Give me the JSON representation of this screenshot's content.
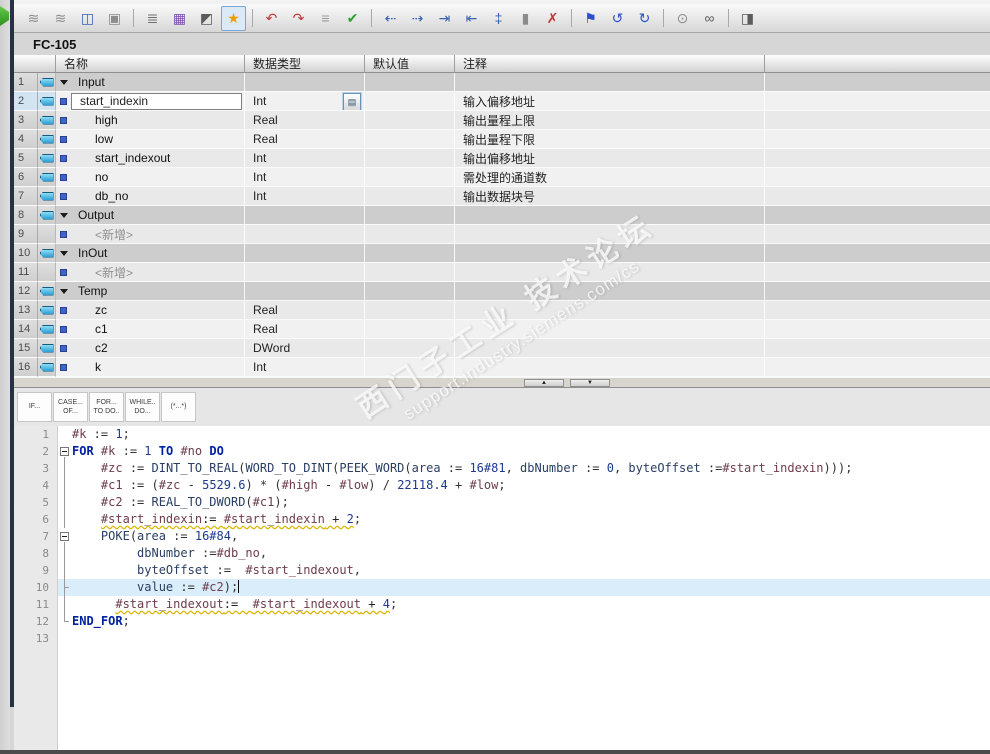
{
  "window": {
    "block_title": "FC-105"
  },
  "toolbar": {
    "icons": [
      {
        "name": "insert-network-icon",
        "glyph": "≋",
        "color": "#8c8c8c"
      },
      {
        "name": "insert-empty-box-icon",
        "glyph": "≋",
        "color": "#8c8c8c"
      },
      {
        "name": "open-block-icon",
        "glyph": "◫",
        "color": "#3a62b0"
      },
      {
        "name": "paste-block-icon",
        "glyph": "▣",
        "color": "#8c8c8c"
      },
      {
        "sep": true
      },
      {
        "name": "network-list-icon",
        "glyph": "≣",
        "color": "#6d6d6d"
      },
      {
        "name": "db-block-icon",
        "glyph": "▦",
        "color": "#7a4fb0"
      },
      {
        "name": "absolute-operands-icon",
        "glyph": "◩",
        "color": "#5c5c5c"
      },
      {
        "name": "snippets-icon",
        "glyph": "★",
        "color": "#e8a000",
        "active": true
      },
      {
        "sep": true
      },
      {
        "name": "undo-call-icon",
        "glyph": "↶",
        "color": "#c23434"
      },
      {
        "name": "redo-call-icon",
        "glyph": "↷",
        "color": "#c23434"
      },
      {
        "name": "format-lines-icon",
        "glyph": "≡",
        "color": "#9a9a9a"
      },
      {
        "name": "consistency-check-icon",
        "glyph": "✔",
        "color": "#2f9e2f"
      },
      {
        "sep": true
      },
      {
        "name": "collapse-folds-icon",
        "glyph": "⇠",
        "color": "#3a62b0"
      },
      {
        "name": "expand-folds-icon",
        "glyph": "⇢",
        "color": "#3a62b0"
      },
      {
        "name": "indent-icon",
        "glyph": "⇥",
        "color": "#3a62b0"
      },
      {
        "name": "outdent-icon",
        "glyph": "⇤",
        "color": "#3a62b0"
      },
      {
        "name": "renumber-icon",
        "glyph": "‡",
        "color": "#3a62b0"
      },
      {
        "name": "absolute-relative-icon",
        "glyph": "▮",
        "color": "#8c8c8c"
      },
      {
        "name": "remove-marks-icon",
        "glyph": "✗",
        "color": "#c23434"
      },
      {
        "sep": true
      },
      {
        "name": "bookmark-icon",
        "glyph": "⚑",
        "color": "#2a4fd0"
      },
      {
        "name": "previous-position-icon",
        "glyph": "↺",
        "color": "#2a4fd0"
      },
      {
        "name": "next-position-icon",
        "glyph": "↻",
        "color": "#2a4fd0"
      },
      {
        "sep": true
      },
      {
        "name": "find-replace-icon",
        "glyph": "⊙",
        "color": "#8c8c8c"
      },
      {
        "name": "monitor-glasses-icon",
        "glyph": "∞",
        "color": "#5c5c5c"
      },
      {
        "sep": true
      },
      {
        "name": "switch-view-icon",
        "glyph": "◨",
        "color": "#5c5c5c"
      }
    ]
  },
  "table": {
    "headers": {
      "name": "名称",
      "type": "数据类型",
      "default": "默认值",
      "comment": "注释"
    },
    "rows": [
      {
        "num": "1",
        "kind": "section",
        "icon": true,
        "name": "Input",
        "type": "",
        "comment": ""
      },
      {
        "num": "2",
        "kind": "edit",
        "icon": true,
        "name": "start_indexin",
        "type": "Int",
        "comment": "输入偏移地址",
        "browse": true,
        "selected": true
      },
      {
        "num": "3",
        "kind": "child",
        "icon": true,
        "name": "high",
        "type": "Real",
        "comment": "输出量程上限"
      },
      {
        "num": "4",
        "kind": "child",
        "icon": true,
        "name": "low",
        "type": "Real",
        "comment": "输出量程下限"
      },
      {
        "num": "5",
        "kind": "child",
        "icon": true,
        "name": "start_indexout",
        "type": "Int",
        "comment": "输出偏移地址"
      },
      {
        "num": "6",
        "kind": "child",
        "icon": true,
        "name": "no",
        "type": "Int",
        "comment": "需处理的通道数"
      },
      {
        "num": "7",
        "kind": "child",
        "icon": true,
        "name": "db_no",
        "type": "Int",
        "comment": "输出数据块号"
      },
      {
        "num": "8",
        "kind": "section",
        "icon": true,
        "name": "Output",
        "type": "",
        "comment": ""
      },
      {
        "num": "9",
        "kind": "new",
        "icon": false,
        "name": "<新增>",
        "type": "",
        "comment": ""
      },
      {
        "num": "10",
        "kind": "section",
        "icon": true,
        "name": "InOut",
        "type": "",
        "comment": ""
      },
      {
        "num": "11",
        "kind": "new",
        "icon": false,
        "name": "<新增>",
        "type": "",
        "comment": ""
      },
      {
        "num": "12",
        "kind": "section",
        "icon": true,
        "name": "Temp",
        "type": "",
        "comment": ""
      },
      {
        "num": "13",
        "kind": "child",
        "icon": true,
        "name": "zc",
        "type": "Real",
        "comment": ""
      },
      {
        "num": "14",
        "kind": "child",
        "icon": true,
        "name": "c1",
        "type": "Real",
        "comment": ""
      },
      {
        "num": "15",
        "kind": "child",
        "icon": true,
        "name": "c2",
        "type": "DWord",
        "comment": ""
      },
      {
        "num": "16",
        "kind": "child",
        "icon": true,
        "name": "k",
        "type": "Int",
        "comment": ""
      }
    ]
  },
  "splitter": {
    "up_glyph": "▲",
    "down_glyph": "▼"
  },
  "snippets": {
    "buttons": [
      {
        "name": "snippet-if-button",
        "lines": [
          "IF..."
        ]
      },
      {
        "name": "snippet-case-button",
        "lines": [
          "CASE...",
          "OF..."
        ]
      },
      {
        "name": "snippet-for-button",
        "lines": [
          "FOR...",
          "TO DO.."
        ]
      },
      {
        "name": "snippet-while-button",
        "lines": [
          "WHILE..",
          "DO..."
        ]
      },
      {
        "name": "snippet-comment-button",
        "lines": [
          "(*...*)"
        ]
      }
    ]
  },
  "code": {
    "lines": [
      {
        "n": "1",
        "fold": "",
        "seg": [
          [
            "#k",
            "var"
          ],
          [
            " := "
          ],
          [
            "1",
            "num"
          ],
          [
            ";"
          ]
        ]
      },
      {
        "n": "2",
        "fold": "box",
        "seg": [
          [
            "FOR",
            "kw"
          ],
          [
            " "
          ],
          [
            "#k",
            "var"
          ],
          [
            " := "
          ],
          [
            "1",
            "num"
          ],
          [
            " "
          ],
          [
            "TO",
            "kw"
          ],
          [
            " "
          ],
          [
            "#no",
            "var"
          ],
          [
            " "
          ],
          [
            "DO",
            "kw"
          ]
        ]
      },
      {
        "n": "3",
        "fold": "bar",
        "seg": [
          [
            "    "
          ],
          [
            "#zc",
            "var"
          ],
          [
            " := "
          ],
          [
            "DINT_TO_REAL",
            "fn"
          ],
          [
            "("
          ],
          [
            "WORD_TO_DINT",
            "fn"
          ],
          [
            "("
          ],
          [
            "PEEK_WORD",
            "fn"
          ],
          [
            "("
          ],
          [
            "area",
            "fn"
          ],
          [
            " := "
          ],
          [
            "16#81",
            "num"
          ],
          [
            ", "
          ],
          [
            "dbNumber",
            "fn"
          ],
          [
            " := "
          ],
          [
            "0",
            "num"
          ],
          [
            ", "
          ],
          [
            "byteOffset",
            "fn"
          ],
          [
            " :="
          ],
          [
            "#start_indexin",
            "var"
          ],
          [
            ")));"
          ]
        ]
      },
      {
        "n": "4",
        "fold": "bar",
        "seg": [
          [
            "    "
          ],
          [
            "#c1",
            "var"
          ],
          [
            " := ("
          ],
          [
            "#zc",
            "var"
          ],
          [
            " - "
          ],
          [
            "5529.6",
            "num"
          ],
          [
            ") * ("
          ],
          [
            "#high",
            "var"
          ],
          [
            " - "
          ],
          [
            "#low",
            "var"
          ],
          [
            ") / "
          ],
          [
            "22118.4",
            "num"
          ],
          [
            " + "
          ],
          [
            "#low",
            "var"
          ],
          [
            ";"
          ]
        ]
      },
      {
        "n": "5",
        "fold": "bar",
        "seg": [
          [
            "    "
          ],
          [
            "#c2",
            "var"
          ],
          [
            " := "
          ],
          [
            "REAL_TO_DWORD",
            "fn"
          ],
          [
            "("
          ],
          [
            "#c1",
            "var"
          ],
          [
            ");"
          ]
        ]
      },
      {
        "n": "6",
        "fold": "bar",
        "seg": [
          [
            "    "
          ],
          [
            "#start_indexin",
            "var warn"
          ],
          [
            ":= ",
            "warn"
          ],
          [
            "#start_indexin",
            "var warn"
          ],
          [
            " + ",
            "warn"
          ],
          [
            "2",
            "num warn"
          ],
          [
            ";"
          ]
        ]
      },
      {
        "n": "7",
        "fold": "box",
        "seg": [
          [
            "    "
          ],
          [
            "POKE",
            "fn"
          ],
          [
            "("
          ],
          [
            "area",
            "fn"
          ],
          [
            " := "
          ],
          [
            "16#84",
            "num"
          ],
          [
            ","
          ]
        ]
      },
      {
        "n": "8",
        "fold": "bar",
        "seg": [
          [
            "         "
          ],
          [
            "dbNumber",
            "fn"
          ],
          [
            " :="
          ],
          [
            "#db_no",
            "var"
          ],
          [
            ","
          ]
        ]
      },
      {
        "n": "9",
        "fold": "bar",
        "seg": [
          [
            "         "
          ],
          [
            "byteOffset",
            "fn"
          ],
          [
            " :=  "
          ],
          [
            "#start_indexout",
            "var"
          ],
          [
            ","
          ]
        ]
      },
      {
        "n": "10",
        "fold": "endbar",
        "cur": true,
        "caret": true,
        "seg": [
          [
            "         "
          ],
          [
            "value",
            "fn"
          ],
          [
            " := "
          ],
          [
            "#c2",
            "var"
          ],
          [
            ");"
          ]
        ]
      },
      {
        "n": "11",
        "fold": "bar",
        "seg": [
          [
            "      "
          ],
          [
            "#start_indexout",
            "var warn"
          ],
          [
            ":=  ",
            "warn"
          ],
          [
            "#start_indexout",
            "var warn"
          ],
          [
            " + ",
            "warn"
          ],
          [
            "4",
            "num warn"
          ],
          [
            ";"
          ]
        ]
      },
      {
        "n": "12",
        "fold": "end",
        "seg": [
          [
            "END_FOR",
            "kw"
          ],
          [
            ";"
          ]
        ]
      },
      {
        "n": "13",
        "fold": "",
        "seg": []
      }
    ]
  },
  "watermark": {
    "line1": "西门子工业 技术论坛",
    "line2": "support.industry.siemens.com/cs"
  },
  "colors": {
    "keyword": "#0021a0",
    "variable": "#6e3c4e",
    "number": "#1d3a8f",
    "function_name": "#2a3f63",
    "warning_underline": "#d9b300",
    "current_line": "#d9eefa",
    "valve_icon_blue": "#2b9fd4",
    "marker_blue": "#3f63c8",
    "window_edge": "#273143"
  }
}
